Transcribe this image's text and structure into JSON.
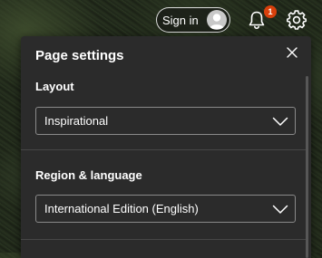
{
  "header": {
    "signin_label": "Sign in",
    "notification_count": "1"
  },
  "icons": {
    "avatar": "person-avatar-icon",
    "notifications": "bell-icon",
    "settings": "gear-icon",
    "close": "close-icon",
    "dropdown": "chevron-down-icon"
  },
  "colors": {
    "badge": "#d8400c",
    "panel_bg": "#2b2b2b"
  },
  "panel": {
    "title": "Page settings",
    "layout": {
      "label": "Layout",
      "value": "Inspirational"
    },
    "region": {
      "label": "Region & language",
      "value": "International Edition (English)"
    }
  }
}
